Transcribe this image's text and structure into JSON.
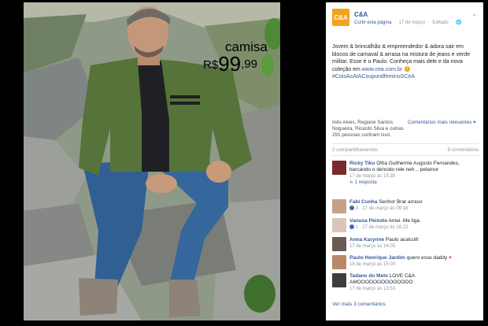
{
  "photo": {
    "price_word": "camisa",
    "price_currency": "R$",
    "price_int": "99",
    "price_cents": ",99"
  },
  "post": {
    "page_name": "C&A",
    "logo_text": "C&A",
    "meta": {
      "like_page": "Curtir esta página",
      "sep": "·",
      "date": "17 de março",
      "edited": "Editado",
      "globe": "🌐"
    },
    "text_line1": "Jovem & brincalhão & empreendedor & adora sair em blocos de carnaval & arrasa na mistura de jeans e verde militar. Esse é o Paulo. Conheça mais dele e da nova coleção em",
    "text_link": "www.cea.com.br",
    "text_emoji": "😊",
    "hashtag": "#CoisAcAtACoupondfeminoSCeA",
    "reactions_left": "Inês Alves, Regiane Santos Nogueira, Ricardo Silva e outras 291 pessoas curtiram isso.",
    "reactions_right": "Comentários mais relevantes ▾",
    "shares": "2 compartilhamentos",
    "comments_count": "9 comentários",
    "comments": [
      {
        "author": "Ricky Tiku",
        "text": "Olha Guilherme Augusto Fernandes, barcando o dencido rele neh... pelamor",
        "meta": "17 de março às 15:38",
        "reply": "↳ 1 resposta",
        "avatar": "#7a2a2a"
      },
      {
        "author": "Fabi Cunha",
        "text": "Senhor Brar arraso",
        "meta": "3 · 17 de março às 09:18",
        "avatar": "#c7a089"
      },
      {
        "author": "Vanusa Peixoto",
        "text": "Amei. Me liga.",
        "meta": "1 · 17 de março às 16:22",
        "avatar": "#d8c6b8"
      },
      {
        "author": "Anna Karynne",
        "text": "Paulo acalcull!",
        "meta": "17 de março às 16:05",
        "avatar": "#6b5a52"
      },
      {
        "author": "Paulo Henrique Jardim",
        "text": "quero esse daddy",
        "meta": "18 de março às 15:00",
        "avatar": "#b98968"
      },
      {
        "author": "Tadano do Melo",
        "text": "LOVE C&A AMOOOOOOOOOOOOOO",
        "meta": "17 de março às 13:53",
        "avatar": "#3d3d3d"
      }
    ],
    "more_comments": "Ver mais 3 comentários"
  },
  "colors": {
    "brand": "#f4a21d",
    "link": "#365899",
    "meta": "#90949c"
  }
}
